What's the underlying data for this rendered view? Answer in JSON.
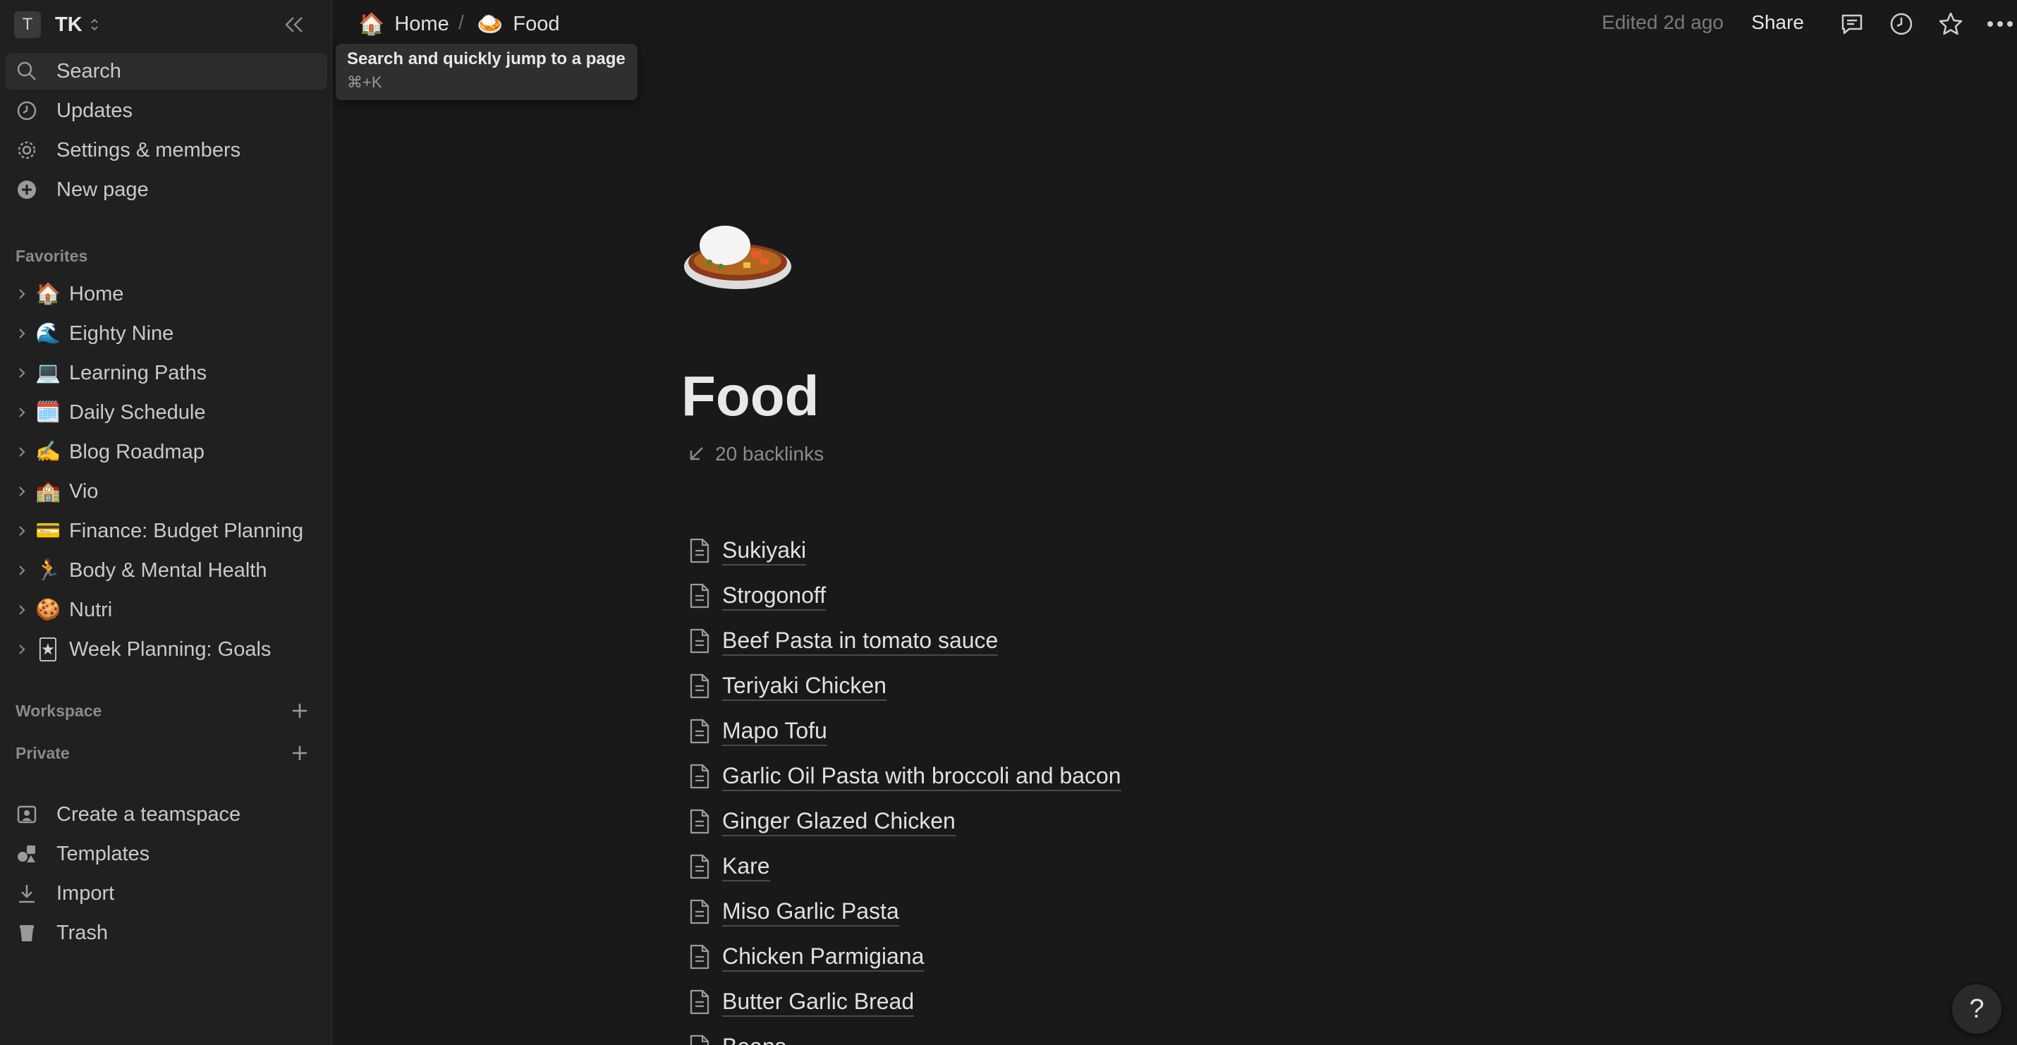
{
  "workspace": {
    "initial": "T",
    "name": "TK"
  },
  "sidebar": {
    "top_items": [
      {
        "label": "Search",
        "icon": "search-icon"
      },
      {
        "label": "Updates",
        "icon": "clock-icon"
      },
      {
        "label": "Settings & members",
        "icon": "gear-icon"
      },
      {
        "label": "New page",
        "icon": "plus-circle-icon"
      }
    ],
    "favorites_label": "Favorites",
    "favorites": [
      {
        "emoji": "🏠",
        "label": "Home"
      },
      {
        "emoji": "🌊",
        "label": "Eighty Nine"
      },
      {
        "emoji": "💻",
        "label": "Learning Paths"
      },
      {
        "emoji": "🗓️",
        "label": "Daily Schedule"
      },
      {
        "emoji": "✍️",
        "label": "Blog Roadmap"
      },
      {
        "emoji": "🏫",
        "label": "Vio"
      },
      {
        "emoji": "💳",
        "label": "Finance: Budget Planning"
      },
      {
        "emoji": "🏃",
        "label": "Body & Mental Health"
      },
      {
        "emoji": "🍪",
        "label": "Nutri"
      },
      {
        "emoji": "🃏",
        "label": "Week Planning: Goals"
      }
    ],
    "workspace_label": "Workspace",
    "private_label": "Private",
    "bottom_items": [
      {
        "label": "Create a teamspace",
        "icon": "teamspace-icon"
      },
      {
        "label": "Templates",
        "icon": "templates-icon"
      },
      {
        "label": "Import",
        "icon": "import-icon"
      },
      {
        "label": "Trash",
        "icon": "trash-icon"
      }
    ]
  },
  "topbar": {
    "breadcrumb": [
      {
        "emoji": "🏠",
        "label": "Home"
      },
      {
        "emoji": "🍛",
        "label": "Food"
      }
    ],
    "separator": "/",
    "edited": "Edited 2d ago",
    "share": "Share"
  },
  "tooltip": {
    "title": "Search and quickly jump to a page",
    "shortcut": "⌘+K"
  },
  "page": {
    "title": "Food",
    "backlinks": "20 backlinks",
    "links": [
      "Sukiyaki",
      "Strogonoff",
      "Beef Pasta in tomato sauce",
      "Teriyaki Chicken",
      "Mapo Tofu",
      "Garlic Oil Pasta with broccoli and bacon",
      "Ginger Glazed Chicken",
      "Kare",
      "Miso Garlic Pasta",
      "Chicken Parmigiana",
      "Butter Garlic Bread",
      "Beans"
    ]
  },
  "help": "?"
}
